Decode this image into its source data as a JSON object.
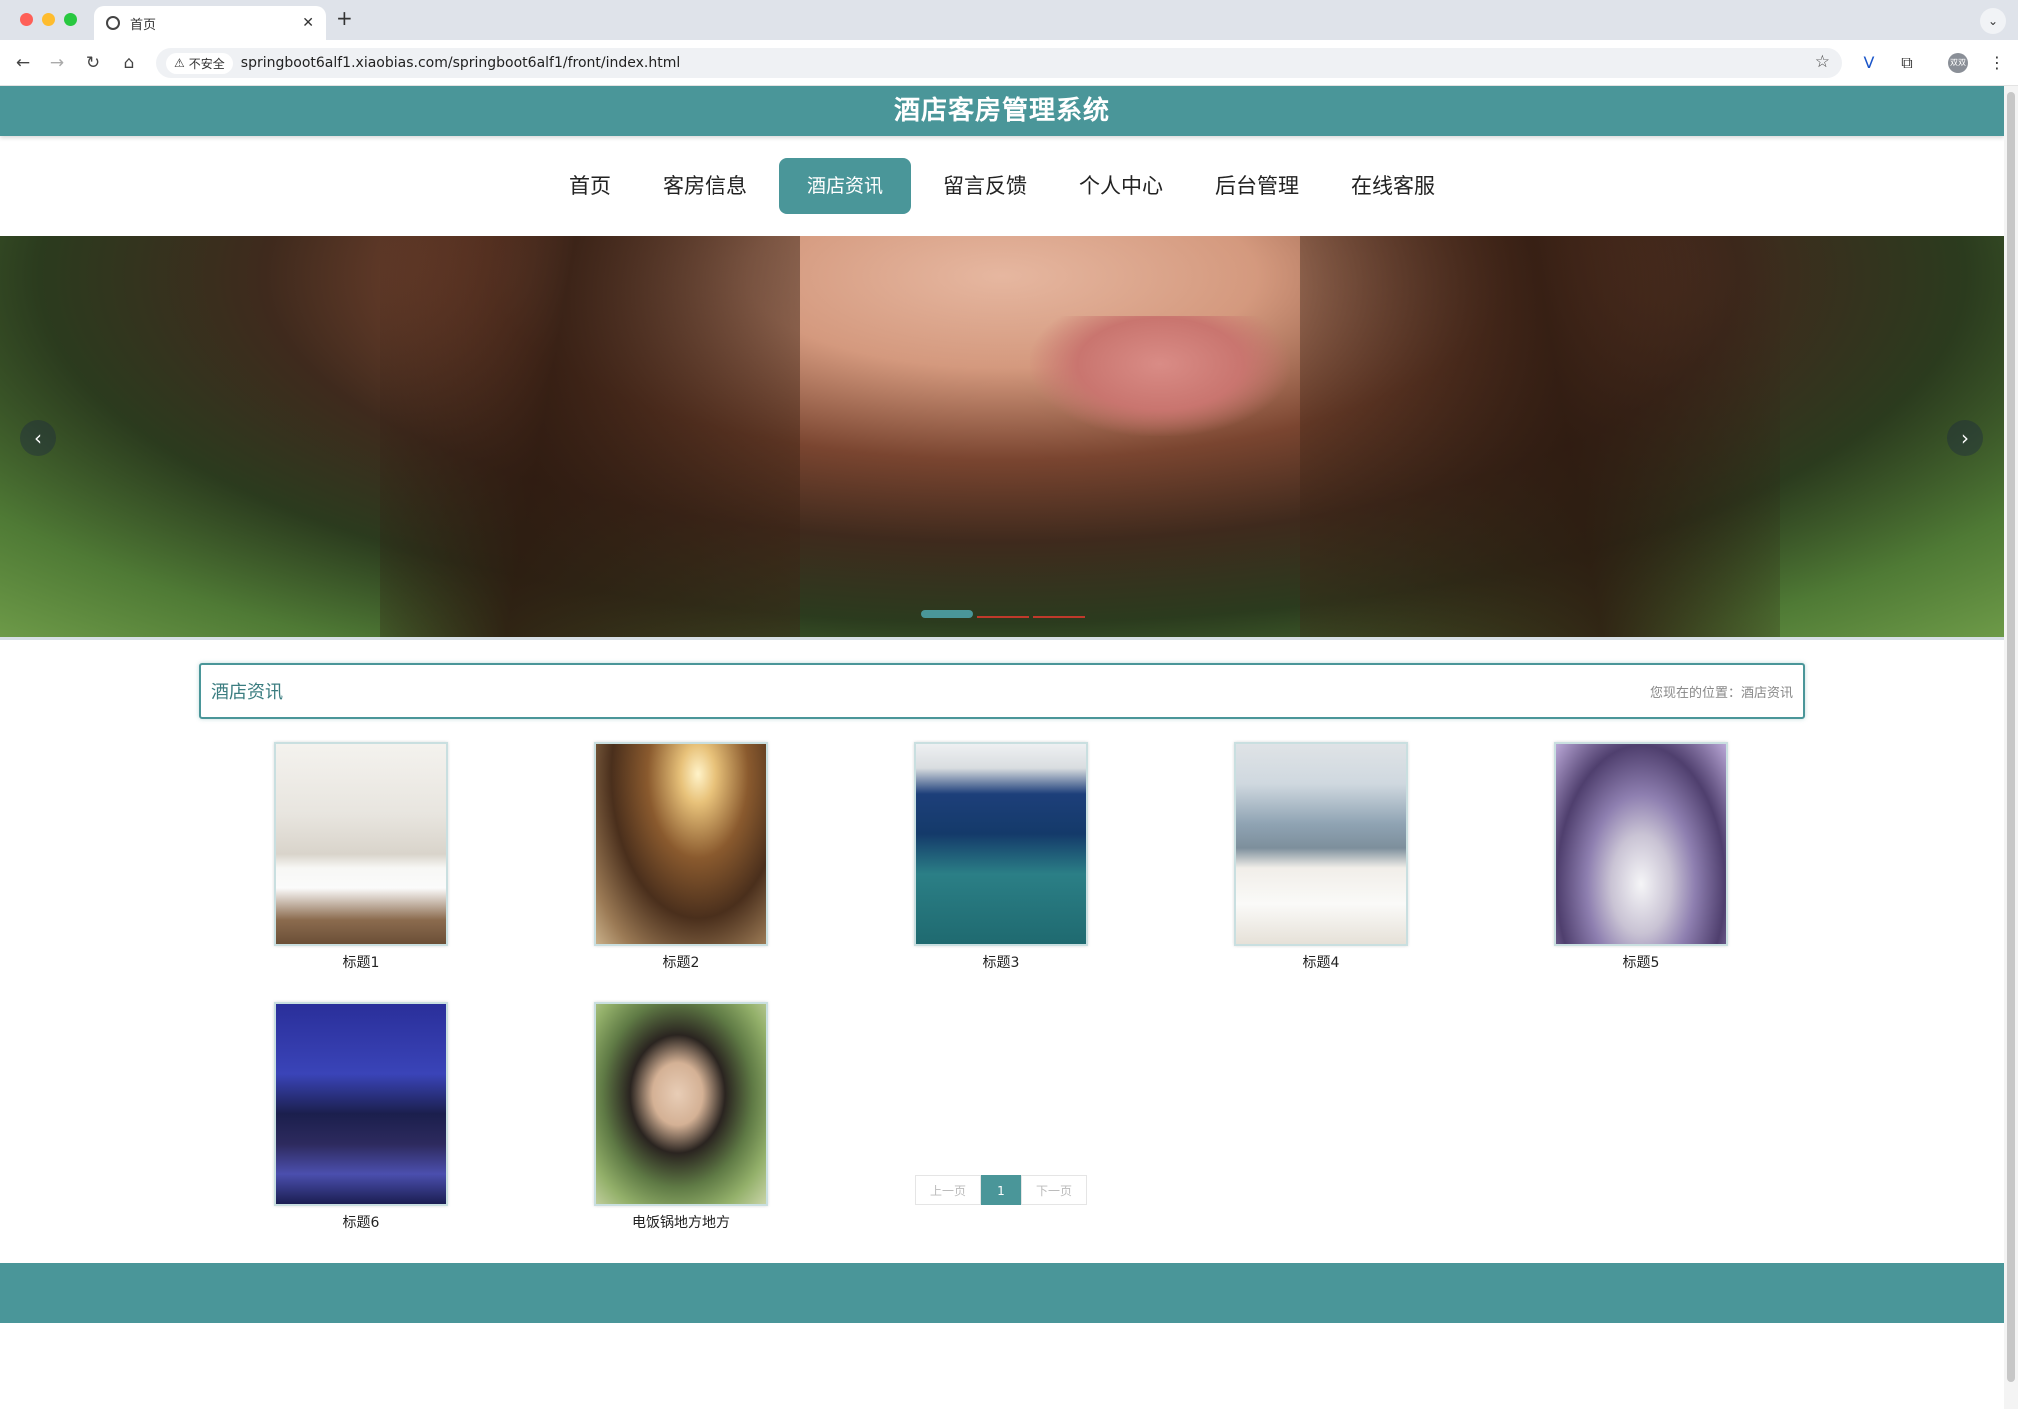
{
  "browser": {
    "tab_title": "首页",
    "tab_close": "✕",
    "new_tab": "+",
    "insecure_label": "不安全",
    "url": "springboot6alf1.xiaobias.com/springboot6alf1/front/index.html",
    "avatar_text": "双双",
    "traffic_light_colors": [
      "#fe5f57",
      "#febc2e",
      "#28c840"
    ]
  },
  "site": {
    "title": "酒店客房管理系统",
    "accent_color": "#4a9699"
  },
  "nav": {
    "items": [
      {
        "label": "首页"
      },
      {
        "label": "客房信息"
      },
      {
        "label": "酒店资讯"
      },
      {
        "label": "留言反馈"
      },
      {
        "label": "个人中心"
      },
      {
        "label": "后台管理"
      },
      {
        "label": "在线客服"
      }
    ],
    "active_index": 2
  },
  "carousel": {
    "prev_icon": "‹",
    "next_icon": "›",
    "indicator_colors": [
      "#4a9699",
      "#c0392b",
      "#c0392b"
    ],
    "active_indicator": 0
  },
  "section": {
    "title": "酒店资讯",
    "location_prefix": "您现在的位置：",
    "location": "酒店资讯"
  },
  "news": [
    {
      "caption": "标题1",
      "image": "bedroom-photo"
    },
    {
      "caption": "标题2",
      "image": "banquet-hall-photo"
    },
    {
      "caption": "标题3",
      "image": "ocean-view-room-photo"
    },
    {
      "caption": "标题4",
      "image": "city-view-room-photo"
    },
    {
      "caption": "标题5",
      "image": "bathtub-suite-photo"
    },
    {
      "caption": "标题6",
      "image": "city-night-photo"
    },
    {
      "caption": "电饭锅地方地方",
      "image": "portrait-photo"
    }
  ],
  "pagination": {
    "prev": "上一页",
    "current": "1",
    "next": "下一页"
  }
}
